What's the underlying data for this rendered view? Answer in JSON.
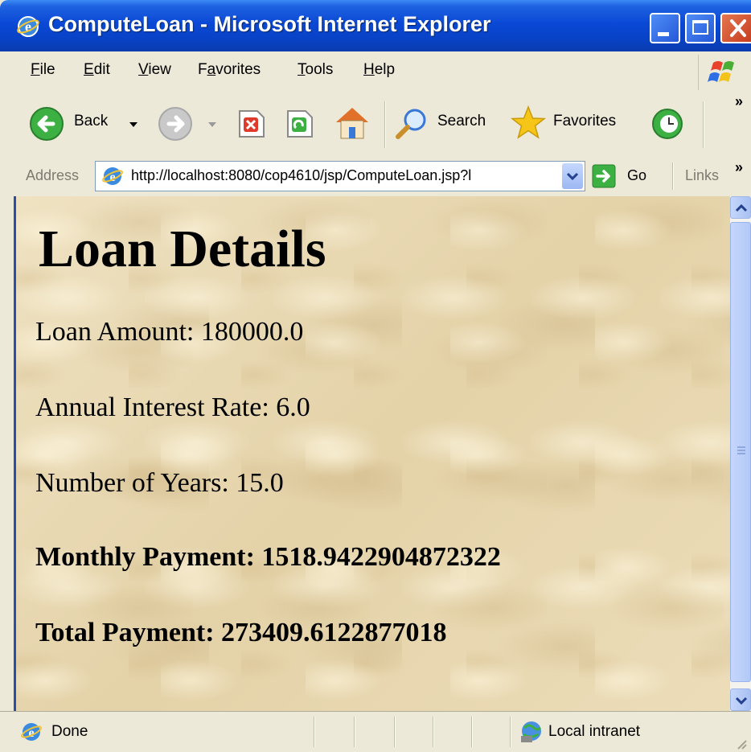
{
  "window": {
    "title": "ComputeLoan - Microsoft Internet Explorer"
  },
  "menu": {
    "items": [
      {
        "key": "F",
        "rest": "ile"
      },
      {
        "key": "E",
        "rest": "dit"
      },
      {
        "key": "V",
        "rest": "iew"
      },
      {
        "pre": "F",
        "key": "a",
        "rest": "vorites"
      },
      {
        "key": "T",
        "rest": "ools"
      },
      {
        "key": "H",
        "rest": "elp"
      }
    ]
  },
  "toolbar": {
    "back_label": "Back",
    "search_label": "Search",
    "favorites_label": "Favorites",
    "more_glyph": "»"
  },
  "address": {
    "label": "Address",
    "url": "http://localhost:8080/cop4610/jsp/ComputeLoan.jsp?l",
    "go_label": "Go",
    "links_label": "Links",
    "more_glyph": "»"
  },
  "page": {
    "heading": "Loan Details",
    "lines": [
      "Loan Amount: 180000.0",
      "Annual Interest Rate: 6.0",
      "Number of Years: 15.0",
      "Monthly Payment: 1518.9422904872322",
      "Total Payment: 273409.6122877018"
    ]
  },
  "status": {
    "text": "Done",
    "zone": "Local intranet"
  },
  "colors": {
    "titlebar": "#0a49d6",
    "chrome": "#ece9d8",
    "page_background": "#eadbb5"
  }
}
